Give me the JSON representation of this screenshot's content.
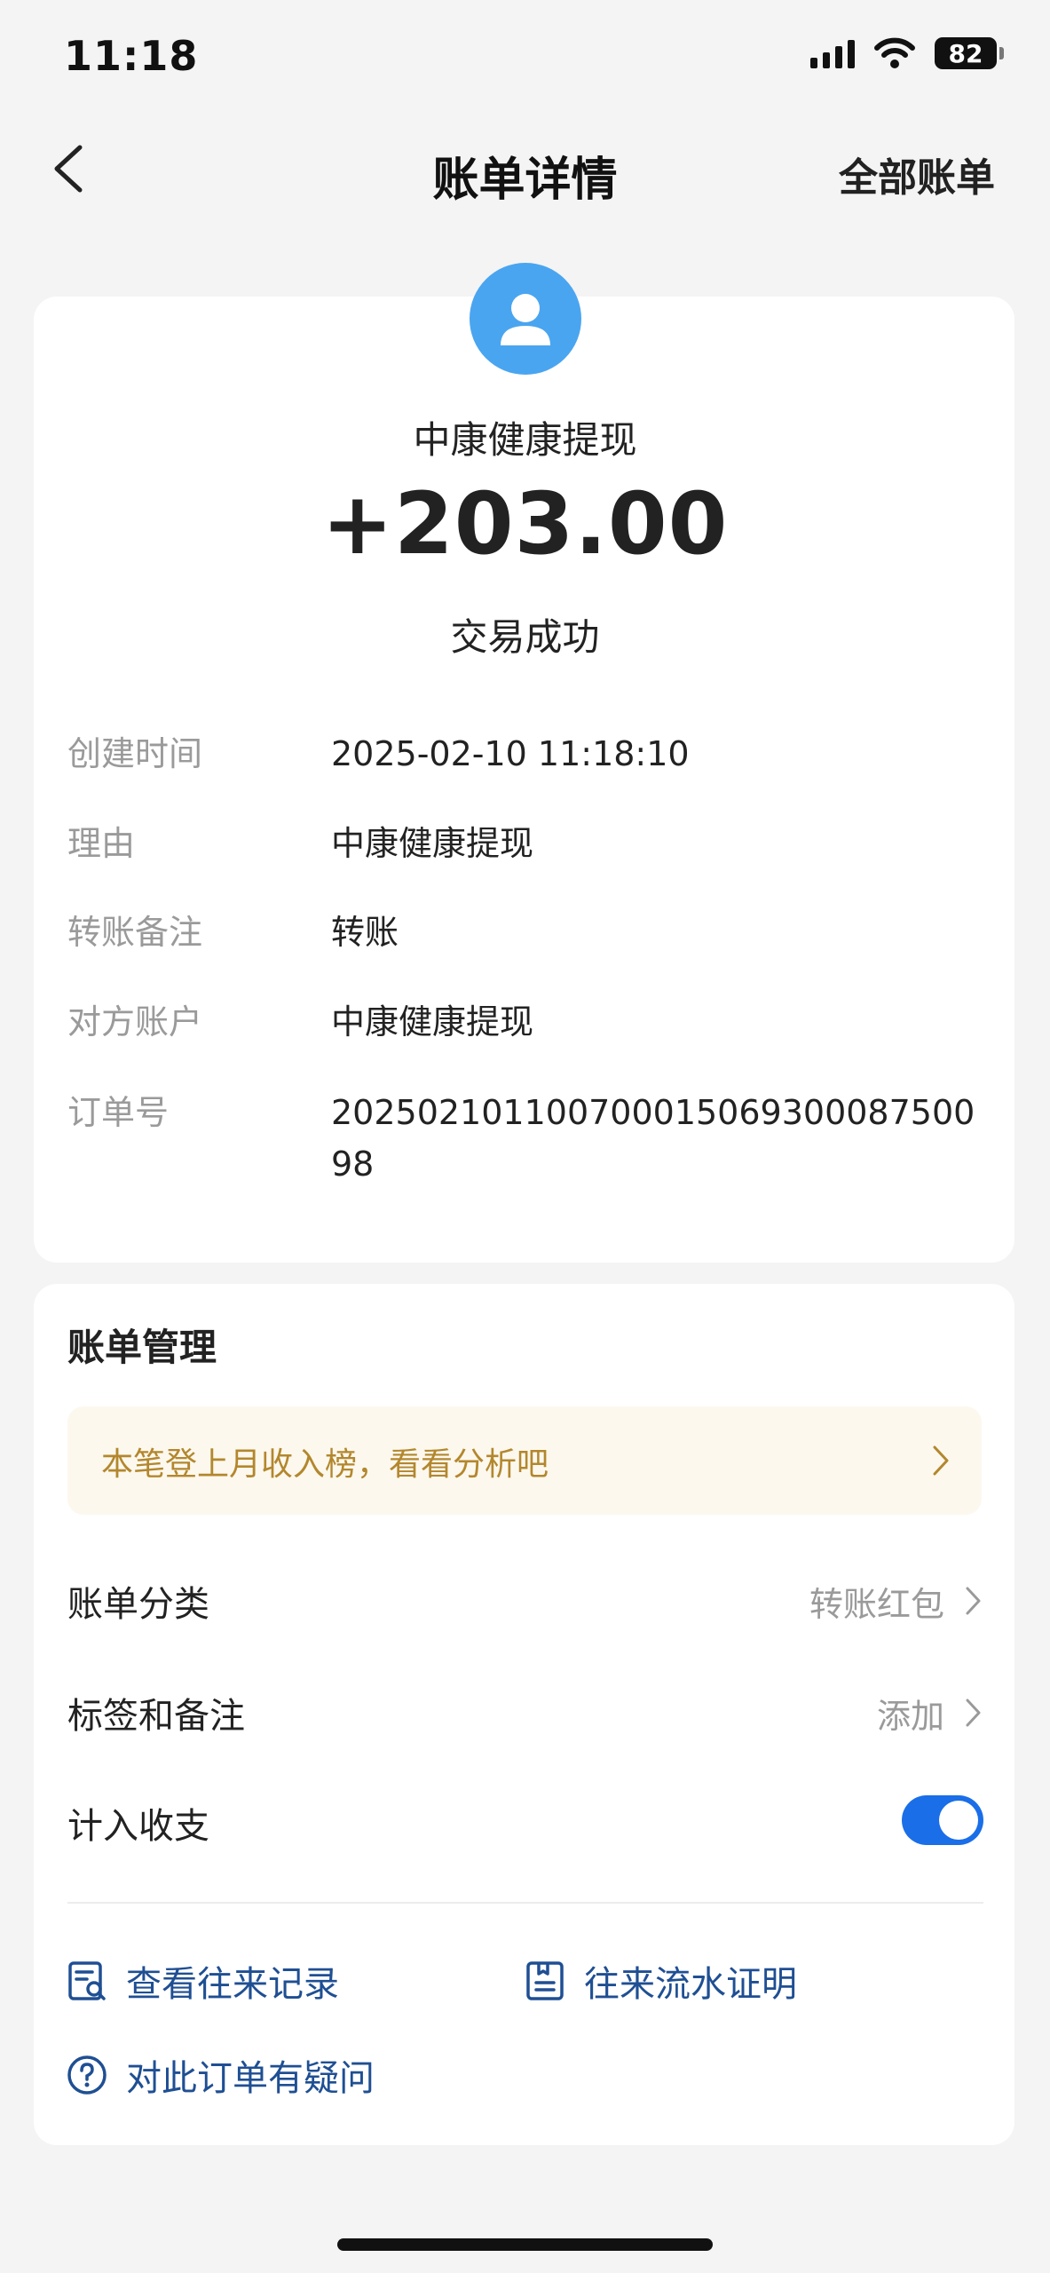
{
  "status_bar": {
    "time": "11:18",
    "battery": "82"
  },
  "nav": {
    "title": "账单详情",
    "right_label": "全部账单"
  },
  "transaction": {
    "merchant": "中康健康提现",
    "amount": "+203.00",
    "status": "交易成功"
  },
  "details": [
    {
      "label": "创建时间",
      "value": "2025-02-10 11:18:10"
    },
    {
      "label": "理由",
      "value": "中康健康提现"
    },
    {
      "label": "转账备注",
      "value": "转账"
    },
    {
      "label": "对方账户",
      "value": "中康健康提现"
    },
    {
      "label": "订单号",
      "value": "20250210110070001506930008750098"
    }
  ],
  "management": {
    "title": "账单管理",
    "banner": "本笔登上月收入榜，看看分析吧",
    "rows": [
      {
        "label": "账单分类",
        "value": "转账红包"
      },
      {
        "label": "标签和备注",
        "value": "添加"
      },
      {
        "label": "计入收支",
        "toggle": true
      }
    ]
  },
  "links": {
    "records": "查看往来记录",
    "proof": "往来流水证明",
    "question": "对此订单有疑问"
  },
  "colors": {
    "accent_blue": "#1a6ee8",
    "avatar_blue": "#4aa5f0",
    "banner_bg": "#fcf8ee",
    "banner_text": "#b3872d",
    "link_blue": "#1f4f93"
  },
  "icons": [
    "back-chevron-icon",
    "signal-icon",
    "wifi-icon",
    "battery-icon",
    "user-avatar-icon",
    "chevron-right-icon",
    "records-icon",
    "proof-icon",
    "question-icon"
  ]
}
